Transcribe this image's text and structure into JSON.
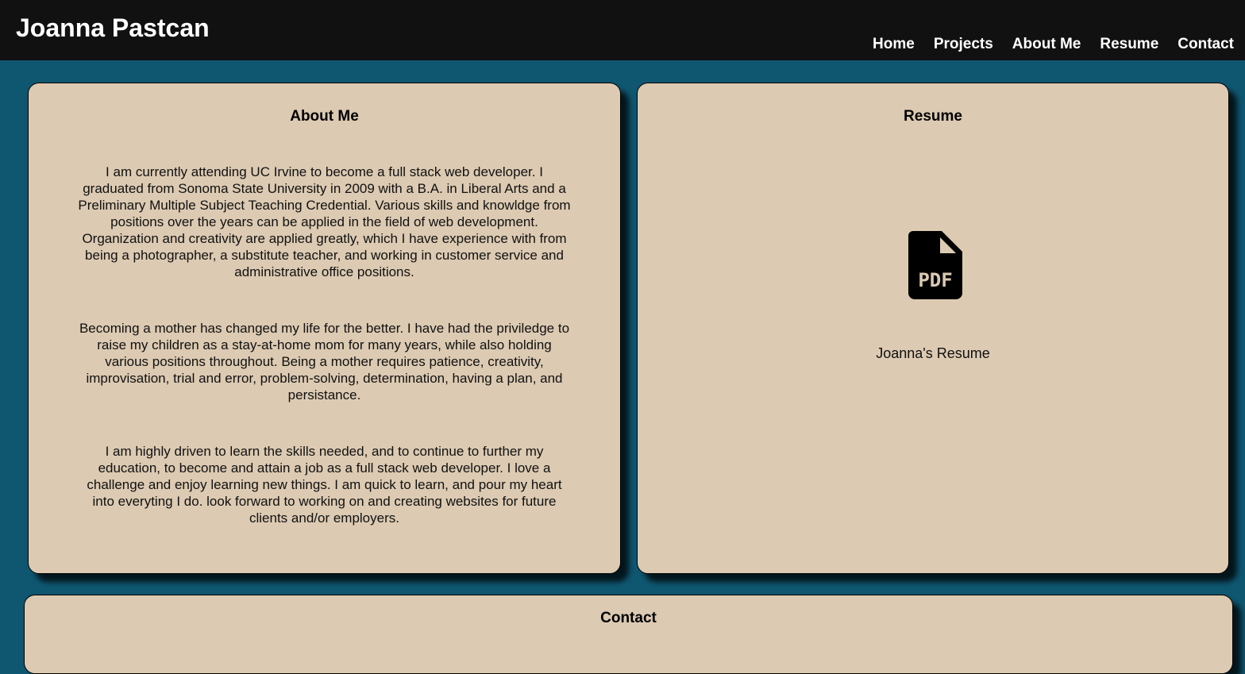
{
  "header": {
    "site_title": "Joanna Pastcan",
    "nav": [
      "Home",
      "Projects",
      "About Me",
      "Resume",
      "Contact"
    ]
  },
  "about": {
    "title": "About Me",
    "paragraphs": [
      "I am currently attending UC Irvine to become a full stack web developer. I graduated from Sonoma State University in 2009 with a B.A. in Liberal Arts and a Preliminary Multiple Subject Teaching Credential. Various skills and knowldge from positions over the years can be applied in the field of web development. Organization and creativity are applied greatly, which I have experience with from being a photographer, a substitute teacher, and working in customer service and administrative office positions.",
      "Becoming a mother has changed my life for the better. I have had the priviledge to raise my children as a stay-at-home mom for many years, while also holding various positions throughout. Being a mother requires patience, creativity, improvisation, trial and error, problem-solving, determination, having a plan, and persistance.",
      "I am highly driven to learn the skills needed, and to continue to further my education, to become and attain a job as a full stack web developer. I love a challenge and enjoy learning new things. I am quick to learn, and pour my heart into everyting I do. look forward to working on and creating websites for future clients and/or employers."
    ]
  },
  "resume": {
    "title": "Resume",
    "icon": "file-pdf-icon",
    "link_label": "Joanna's Resume",
    "icon_text": "PDF"
  },
  "contact": {
    "title": "Contact"
  },
  "colors": {
    "page_background": "#0f5670",
    "header_background": "#111111",
    "card_background": "#dccab2"
  }
}
